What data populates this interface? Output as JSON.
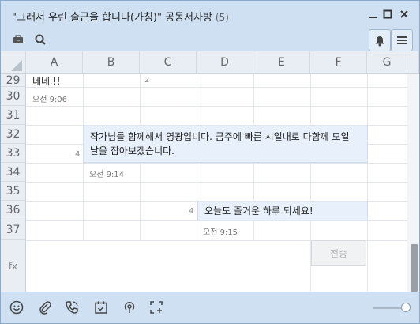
{
  "window": {
    "title": "\"그래서 우린 출근을 합니다(가칭)\" 공동저자방",
    "member_count": "(5)"
  },
  "columns": [
    "A",
    "B",
    "C",
    "D",
    "E",
    "F",
    "G"
  ],
  "rows": [
    "29",
    "30",
    "31",
    "32",
    "33",
    "34",
    "35",
    "36",
    "37"
  ],
  "formula_label": "fx",
  "messages": {
    "m1_text": "네네 !!",
    "m1_unread": "2",
    "m1_time": "오전 9:06",
    "m2_text": "작가님들 함께해서 영광입니다. 금주에 빠른 시일내로 다함께 모일 날을 잡아보겠습니다.",
    "m2_unread": "4",
    "m2_time": "오전 9:14",
    "m3_text": "오늘도 즐거운 하루 되세요!",
    "m3_unread": "4",
    "m3_time": "오전 9:15"
  },
  "send_label": "전송",
  "colors": {
    "accent": "#cfe0f2",
    "bubble": "#e8f1fb",
    "header": "#e9eef4"
  }
}
